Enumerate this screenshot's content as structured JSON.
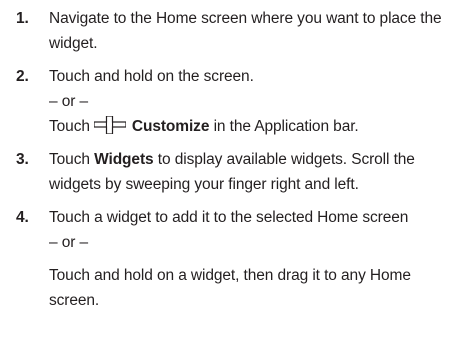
{
  "steps": [
    {
      "number": "1.",
      "lines": [
        "Navigate to the Home screen where you want to place the",
        "widget."
      ]
    },
    {
      "number": "2.",
      "line1": "Touch and hold on the screen.",
      "or": "– or –",
      "touch": "Touch",
      "customize": "Customize",
      "tail": "in the Application bar."
    },
    {
      "number": "3.",
      "touch": "Touch",
      "widgets": "Widgets",
      "rest1": "to display available widgets. Scroll the",
      "line2": "widgets by sweeping your finger right and left."
    },
    {
      "number": "4.",
      "line1": "Touch a widget to add it to the selected Home screen",
      "or": "– or –",
      "line3": "Touch and hold on a widget, then drag it to any Home",
      "line4": "screen."
    }
  ],
  "icons": {
    "customize": "plus-icon"
  }
}
